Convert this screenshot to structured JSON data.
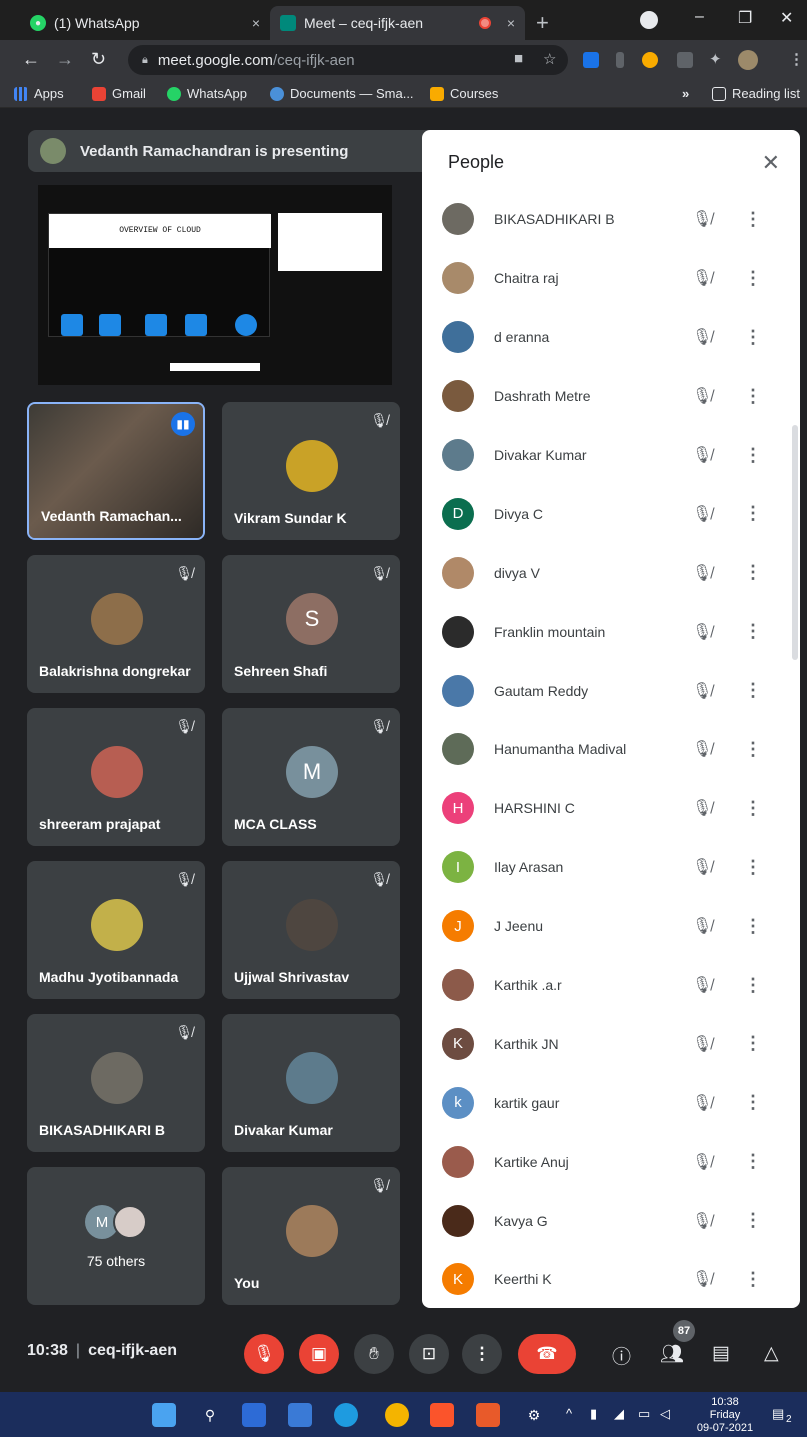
{
  "browser": {
    "tabs": [
      {
        "label": "(1) WhatsApp",
        "close": "×"
      },
      {
        "label": "Meet – ceq-ifjk-aen",
        "close": "×"
      }
    ],
    "new_tab": "+",
    "window_controls": {
      "minimize": "–",
      "maximize": "❐",
      "close": "✕"
    },
    "url_host": "meet.google.com",
    "url_path": "/ceq-ifjk-aen",
    "bookmarks": [
      "Apps",
      "Gmail",
      "WhatsApp",
      "Documents — Sma...",
      "Courses"
    ],
    "bookmarks_more": "»",
    "reading_list": "Reading list"
  },
  "meet": {
    "presenting": "Vedanth Ramachandran is presenting",
    "slide_title": "OVERVIEW OF CLOUD",
    "tiles": [
      {
        "name": "Vedanth Ramachan...",
        "type": "video",
        "speaking": true
      },
      {
        "name": "Vikram Sundar K",
        "type": "photo",
        "color": "#c9a227",
        "muted": true
      },
      {
        "name": "Balakrishna dongrekar",
        "type": "photo",
        "color": "#8d6e4a",
        "muted": true
      },
      {
        "name": "Sehreen Shafi",
        "type": "initial",
        "initial": "S",
        "color": "#8d6e63",
        "muted": true
      },
      {
        "name": "shreeram prajapat",
        "type": "photo",
        "color": "#b75e52",
        "muted": true
      },
      {
        "name": "MCA CLASS",
        "type": "initial",
        "initial": "M",
        "color": "#78909c",
        "muted": true
      },
      {
        "name": "Madhu Jyotibannada",
        "type": "photo",
        "color": "#c2b04a",
        "muted": true
      },
      {
        "name": "Ujjwal Shrivastav",
        "type": "photo",
        "color": "#4e4640",
        "muted": true
      },
      {
        "name": "BIKASADHIKARI B",
        "type": "photo",
        "color": "#6d6a62",
        "muted": true
      },
      {
        "name": "Divakar Kumar",
        "type": "photo",
        "color": "#5d7b8c",
        "muted": false
      },
      {
        "name": "75 others",
        "type": "others",
        "initial": "M",
        "color": "#78909c",
        "muted": false
      },
      {
        "name": "You",
        "type": "photo",
        "color": "#9c7a5a",
        "muted": true
      }
    ]
  },
  "people_panel": {
    "title": "People",
    "close": "✕",
    "participants": [
      {
        "name": "BIKASADHIKARI B",
        "avatar": "photo",
        "color": "#6d6a62"
      },
      {
        "name": "Chaitra raj",
        "avatar": "photo",
        "color": "#a88a6a"
      },
      {
        "name": "d eranna",
        "avatar": "photo",
        "color": "#3f6f9a"
      },
      {
        "name": "Dashrath Metre",
        "avatar": "photo",
        "color": "#7a5a3e"
      },
      {
        "name": "Divakar Kumar",
        "avatar": "photo",
        "color": "#5d7b8c"
      },
      {
        "name": "Divya C",
        "avatar": "initial",
        "initial": "D",
        "color": "#0b6e4f"
      },
      {
        "name": "divya V",
        "avatar": "photo",
        "color": "#b08968"
      },
      {
        "name": "Franklin mountain",
        "avatar": "photo",
        "color": "#2b2b2b"
      },
      {
        "name": "Gautam Reddy",
        "avatar": "photo",
        "color": "#4a78a8"
      },
      {
        "name": "Hanumantha Madival",
        "avatar": "photo",
        "color": "#5e6b58"
      },
      {
        "name": "HARSHINI C",
        "avatar": "initial",
        "initial": "H",
        "color": "#ec407a"
      },
      {
        "name": "Ilay Arasan",
        "avatar": "initial",
        "initial": "I",
        "color": "#7cb342"
      },
      {
        "name": "J Jeenu",
        "avatar": "initial",
        "initial": "J",
        "color": "#f57c00"
      },
      {
        "name": "Karthik .a.r",
        "avatar": "photo",
        "color": "#8c5a4a"
      },
      {
        "name": "Karthik JN",
        "avatar": "initial",
        "initial": "K",
        "color": "#6d4c41"
      },
      {
        "name": "kartik gaur",
        "avatar": "initial",
        "initial": "k",
        "color": "#5c8fc4"
      },
      {
        "name": "Kartike Anuj",
        "avatar": "photo",
        "color": "#9a5b4c"
      },
      {
        "name": "Kavya G",
        "avatar": "photo",
        "color": "#4a2a1a"
      },
      {
        "name": "Keerthi K",
        "avatar": "initial",
        "initial": "K",
        "color": "#f57c00"
      }
    ]
  },
  "controls": {
    "time": "10:38",
    "separator": "|",
    "meeting_code": "ceq-ifjk-aen",
    "people_count": "87"
  },
  "taskbar": {
    "time": "10:38",
    "day": "Friday",
    "date": "09-07-2021",
    "notification_count": "2"
  }
}
